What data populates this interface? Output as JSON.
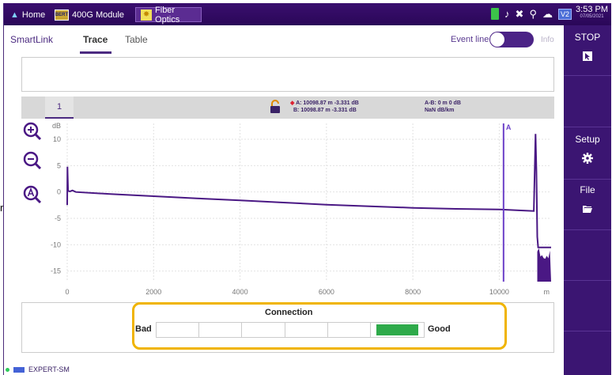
{
  "topbar": {
    "home_label": "Home",
    "module_label": "400G Module",
    "module_badge": "BERT",
    "fiber_label": "Fiber Optics",
    "v2_label": "V2",
    "time": "3:53 PM",
    "date": "07/05/2021"
  },
  "subtabs": {
    "smartlink": "SmartLink",
    "trace": "Trace",
    "table": "Table",
    "event_line": "Event line",
    "info": "Info"
  },
  "rightbar": {
    "stop": "STOP",
    "setup": "Setup",
    "file": "File"
  },
  "trace_header": {
    "tab_number": "1",
    "cursor_a": "A: 10098.87 m -3.331 dB",
    "cursor_b": "B: 10098.87 m -3.331 dB",
    "ab_distance": "A-B: 0 m 0 dB",
    "ab_attenuation": "NaN dB/km"
  },
  "chart_data": {
    "type": "line",
    "ylabel": "dB",
    "xlabel": "m",
    "xlim": [
      0,
      11200
    ],
    "ylim": [
      -17,
      13
    ],
    "x_ticks": [
      0,
      2000,
      4000,
      6000,
      8000,
      10000
    ],
    "y_ticks": [
      10,
      5,
      0,
      -5,
      -10,
      -15
    ],
    "cursor": {
      "label": "A",
      "x": 10098.87
    },
    "series": [
      {
        "x": [
          0,
          5,
          10,
          20,
          60,
          120,
          200,
          1000,
          2000,
          3000,
          4000,
          5000,
          6000,
          7000,
          8000,
          9000,
          10000,
          10500,
          10800,
          10840,
          10860,
          10880,
          10900,
          11200
        ],
        "y": [
          -2.5,
          4.8,
          3.5,
          0.2,
          0.1,
          0.3,
          0.0,
          -0.4,
          -0.8,
          -1.2,
          -1.6,
          -2.0,
          -2.4,
          -2.7,
          -3.0,
          -3.2,
          -3.3,
          -3.5,
          -3.6,
          11.0,
          4.0,
          -8.5,
          -10.5,
          -10.5
        ]
      }
    ],
    "grid": true,
    "color": "#4a1884"
  },
  "connection": {
    "title": "Connection",
    "bad_label": "Bad",
    "good_label": "Good",
    "level": 6,
    "segments": 6
  },
  "bottom_status": {
    "label": "EXPERT-SM"
  },
  "edge_char": "r"
}
